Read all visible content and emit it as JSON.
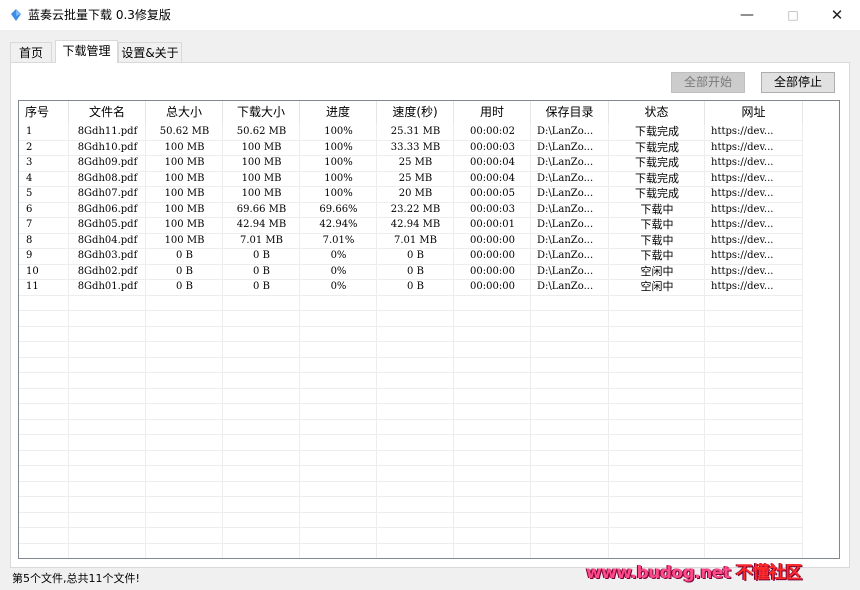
{
  "window": {
    "title": "蓝奏云批量下载 0.3修复版",
    "minimize_glyph": "—",
    "maximize_glyph": "□",
    "close_glyph": "✕"
  },
  "tabs": [
    {
      "label": "首页",
      "active": false
    },
    {
      "label": "下载管理",
      "active": true
    },
    {
      "label": "设置&关于",
      "active": false
    }
  ],
  "toolbar": {
    "start_all_label": "全部开始",
    "start_all_enabled": false,
    "stop_all_label": "全部停止"
  },
  "table": {
    "columns": [
      "序号",
      "文件名",
      "总大小",
      "下载大小",
      "进度",
      "速度(秒)",
      "用时",
      "保存目录",
      "状态",
      "网址"
    ],
    "rows": [
      [
        "1",
        "8Gdh11.pdf",
        "50.62 MB",
        "50.62 MB",
        "100%",
        "25.31 MB",
        "00:00:02",
        "D:\\LanZo...",
        "下载完成",
        "https://dev..."
      ],
      [
        "2",
        "8Gdh10.pdf",
        "100 MB",
        "100 MB",
        "100%",
        "33.33 MB",
        "00:00:03",
        "D:\\LanZo...",
        "下载完成",
        "https://dev..."
      ],
      [
        "3",
        "8Gdh09.pdf",
        "100 MB",
        "100 MB",
        "100%",
        "25 MB",
        "00:00:04",
        "D:\\LanZo...",
        "下载完成",
        "https://dev..."
      ],
      [
        "4",
        "8Gdh08.pdf",
        "100 MB",
        "100 MB",
        "100%",
        "25 MB",
        "00:00:04",
        "D:\\LanZo...",
        "下载完成",
        "https://dev..."
      ],
      [
        "5",
        "8Gdh07.pdf",
        "100 MB",
        "100 MB",
        "100%",
        "20 MB",
        "00:00:05",
        "D:\\LanZo...",
        "下载完成",
        "https://dev..."
      ],
      [
        "6",
        "8Gdh06.pdf",
        "100 MB",
        "69.66 MB",
        "69.66%",
        "23.22 MB",
        "00:00:03",
        "D:\\LanZo...",
        "下载中",
        "https://dev..."
      ],
      [
        "7",
        "8Gdh05.pdf",
        "100 MB",
        "42.94 MB",
        "42.94%",
        "42.94 MB",
        "00:00:01",
        "D:\\LanZo...",
        "下载中",
        "https://dev..."
      ],
      [
        "8",
        "8Gdh04.pdf",
        "100 MB",
        "7.01 MB",
        "7.01%",
        "7.01 MB",
        "00:00:00",
        "D:\\LanZo...",
        "下载中",
        "https://dev..."
      ],
      [
        "9",
        "8Gdh03.pdf",
        "0 B",
        "0 B",
        "0%",
        "0 B",
        "00:00:00",
        "D:\\LanZo...",
        "下载中",
        "https://dev..."
      ],
      [
        "10",
        "8Gdh02.pdf",
        "0 B",
        "0 B",
        "0%",
        "0 B",
        "00:00:00",
        "D:\\LanZo...",
        "空闲中",
        "https://dev..."
      ],
      [
        "11",
        "8Gdh01.pdf",
        "0 B",
        "0 B",
        "0%",
        "0 B",
        "00:00:00",
        "D:\\LanZo...",
        "空闲中",
        "https://dev..."
      ]
    ]
  },
  "statusbar": {
    "text": "第5个文件,总共11个文件!"
  },
  "watermark": {
    "site": "www.budog.net",
    "name": "不懂社区"
  },
  "icons": {
    "app": "app-logo-icon"
  },
  "colors": {
    "accent": "#3a8ee6",
    "watermark_pink": "#ff4b8a",
    "watermark_red": "#ff2a2a"
  }
}
